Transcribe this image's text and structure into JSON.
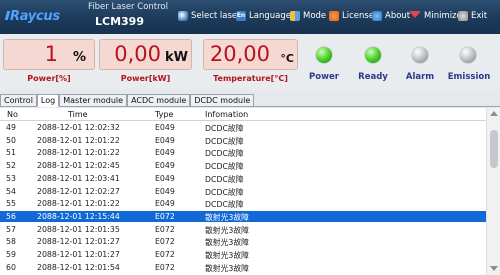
{
  "app": {
    "logo": "Raycus",
    "title": "Fiber Laser Control",
    "model": "LCM399"
  },
  "menu": [
    {
      "label": "Select laser",
      "icon": "laser-icon"
    },
    {
      "label": "Language",
      "icon": "language-icon"
    },
    {
      "label": "Mode",
      "icon": "mode-icon"
    },
    {
      "label": "License",
      "icon": "license-icon"
    },
    {
      "label": "About",
      "icon": "about-icon"
    },
    {
      "label": "Minimize",
      "icon": "minimize-icon"
    },
    {
      "label": "Exit",
      "icon": "exit-icon"
    }
  ],
  "gauges": {
    "power_pct": {
      "value": "1",
      "unit": "%",
      "label": "Power[%]"
    },
    "power_kw": {
      "value": "0,00",
      "unit": "kW",
      "label": "Power[kW]"
    },
    "temperature": {
      "value": "20,00",
      "unit": "°C",
      "label": "Temperature[°C]"
    }
  },
  "indicators": [
    {
      "label": "Power",
      "state": "on",
      "color": "#46c92a"
    },
    {
      "label": "Ready",
      "state": "on",
      "color": "#46c92a"
    },
    {
      "label": "Alarm",
      "state": "off",
      "color": "#b8bcc0"
    },
    {
      "label": "Emission",
      "state": "off",
      "color": "#b8bcc0"
    }
  ],
  "tabs": [
    {
      "label": "Control",
      "active": false
    },
    {
      "label": "Log",
      "active": true
    },
    {
      "label": "Master module",
      "active": false
    },
    {
      "label": "ACDC module",
      "active": false
    },
    {
      "label": "DCDC module",
      "active": false
    }
  ],
  "log": {
    "columns": [
      "No",
      "Time",
      "Type",
      "Infomation"
    ],
    "selected_no": "56",
    "rows": [
      {
        "no": "49",
        "time": "2088-12-01 12:02:32",
        "type": "E049",
        "info": "DCDC故障"
      },
      {
        "no": "50",
        "time": "2088-12-01 12:01:22",
        "type": "E049",
        "info": "DCDC故障"
      },
      {
        "no": "51",
        "time": "2088-12-01 12:01:22",
        "type": "E049",
        "info": "DCDC故障"
      },
      {
        "no": "52",
        "time": "2088-12-01 12:02:45",
        "type": "E049",
        "info": "DCDC故障"
      },
      {
        "no": "53",
        "time": "2088-12-01 12:03:41",
        "type": "E049",
        "info": "DCDC故障"
      },
      {
        "no": "54",
        "time": "2088-12-01 12:02:27",
        "type": "E049",
        "info": "DCDC故障"
      },
      {
        "no": "55",
        "time": "2088-12-01 12:01:22",
        "type": "E049",
        "info": "DCDC故障"
      },
      {
        "no": "56",
        "time": "2088-12-01 12:15:44",
        "type": "E072",
        "info": "散射光3故障"
      },
      {
        "no": "57",
        "time": "2088-12-01 12:01:35",
        "type": "E072",
        "info": "散射光3故障"
      },
      {
        "no": "58",
        "time": "2088-12-01 12:01:27",
        "type": "E072",
        "info": "散射光3故障"
      },
      {
        "no": "59",
        "time": "2088-12-01 12:01:27",
        "type": "E072",
        "info": "散射光3故障"
      },
      {
        "no": "60",
        "time": "2088-12-01 12:01:54",
        "type": "E072",
        "info": "散射光3故障"
      }
    ]
  }
}
